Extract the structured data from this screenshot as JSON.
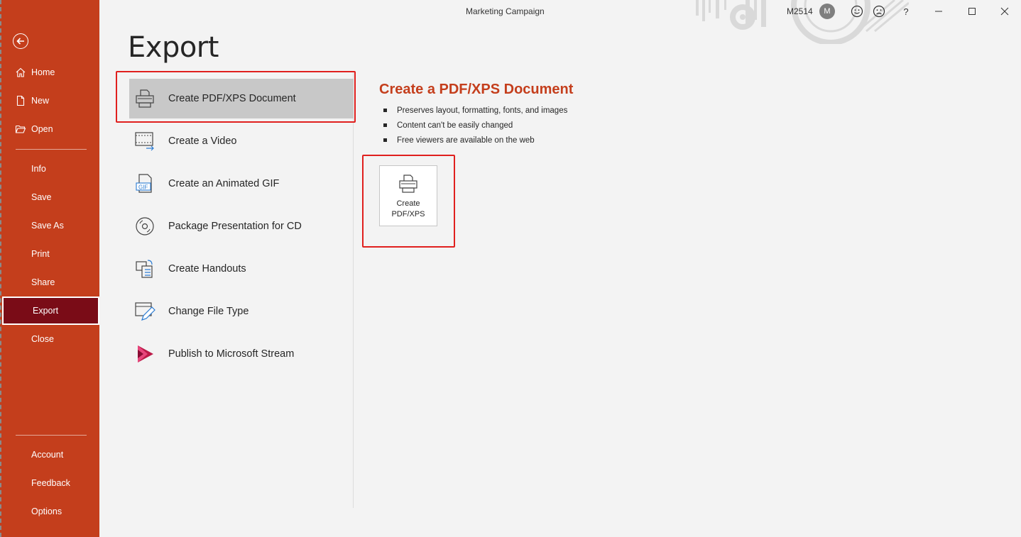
{
  "window": {
    "doc_title": "Marketing Campaign",
    "user_name": "M2514",
    "avatar_initial": "M",
    "help_label": "?"
  },
  "sidebar": {
    "top_items": [
      {
        "label": "Home",
        "icon": "home-icon"
      },
      {
        "label": "New",
        "icon": "new-document-icon"
      },
      {
        "label": "Open",
        "icon": "folder-open-icon"
      }
    ],
    "middle_items": [
      {
        "label": "Info"
      },
      {
        "label": "Save"
      },
      {
        "label": "Save As"
      },
      {
        "label": "Print"
      },
      {
        "label": "Share"
      },
      {
        "label": "Export",
        "active": true
      },
      {
        "label": "Close"
      }
    ],
    "bottom_items": [
      {
        "label": "Account"
      },
      {
        "label": "Feedback"
      },
      {
        "label": "Options"
      }
    ]
  },
  "page": {
    "title": "Export"
  },
  "options": [
    {
      "label": "Create PDF/XPS Document",
      "icon": "pdf-printer-icon",
      "selected": true
    },
    {
      "label": "Create a Video",
      "icon": "video-icon"
    },
    {
      "label": "Create an Animated GIF",
      "icon": "gif-icon"
    },
    {
      "label": "Package Presentation for CD",
      "icon": "cd-icon"
    },
    {
      "label": "Create Handouts",
      "icon": "handouts-icon"
    },
    {
      "label": "Change File Type",
      "icon": "change-file-type-icon"
    },
    {
      "label": "Publish to Microsoft Stream",
      "icon": "stream-icon"
    }
  ],
  "detail": {
    "heading": "Create a PDF/XPS Document",
    "bullets": [
      "Preserves layout, formatting, fonts, and images",
      "Content can't be easily changed",
      "Free viewers are available on the web"
    ],
    "button_line1": "Create",
    "button_line2": "PDF/XPS"
  },
  "colors": {
    "sidebar_bg": "#c43e1c",
    "active_bg": "#7a0c17",
    "accent": "#c43e1c",
    "highlight": "#e0201e"
  }
}
